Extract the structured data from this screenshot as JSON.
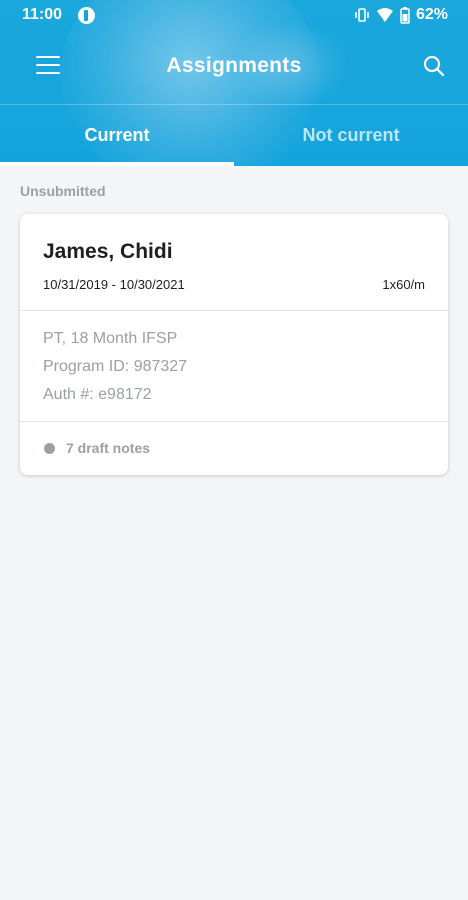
{
  "status_bar": {
    "time": "11:00",
    "battery_percent": "62%",
    "icons": [
      "app-notification-icon",
      "vibrate-icon",
      "wifi-icon",
      "battery-icon"
    ]
  },
  "header": {
    "title": "Assignments",
    "colors": {
      "accent": "#14a4dc",
      "text": "#ffffff"
    }
  },
  "tabs": [
    {
      "label": "Current",
      "active": true
    },
    {
      "label": "Not current",
      "active": false
    }
  ],
  "section": {
    "label": "Unsubmitted"
  },
  "assignment": {
    "name": "James, Chidi",
    "dates": "10/31/2019 - 10/30/2021",
    "frequency": "1x60/m",
    "details": [
      "PT, 18 Month IFSP",
      "Program ID: 987327",
      "Auth #: e98172"
    ],
    "draft_notes": "7 draft notes"
  }
}
